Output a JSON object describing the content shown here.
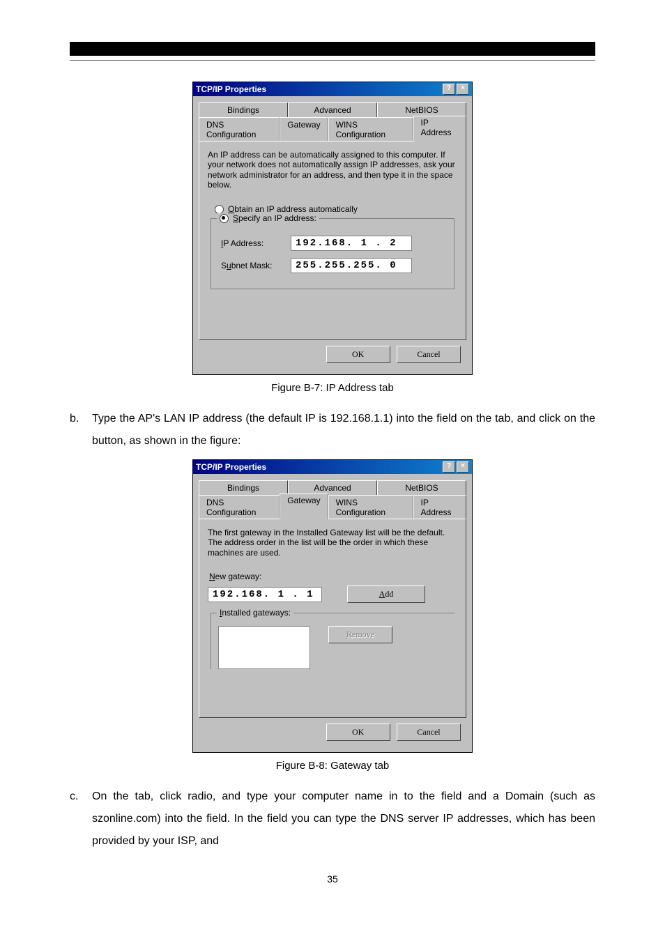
{
  "header_black_bar": "",
  "dialog1": {
    "title": "TCP/IP Properties",
    "help_btn": "?",
    "close_btn": "×",
    "tabs_row1": [
      "Bindings",
      "Advanced",
      "NetBIOS"
    ],
    "tabs_row2": [
      "DNS Configuration",
      "Gateway",
      "WINS Configuration",
      "IP Address"
    ],
    "explain": "An IP address can be automatically assigned to this computer. If your network does not automatically assign IP addresses, ask your network administrator for an address, and then type it in the space below.",
    "radio_obtain_pre": "O",
    "radio_obtain_post": "btain an IP address automatically",
    "radio_specify_pre": "S",
    "radio_specify_post": "pecify an IP address:",
    "ip_label_pre": "I",
    "ip_label_post": "P Address:",
    "ip_value": "192.168. 1 .  2",
    "subnet_label_pre": "u",
    "subnet_label_prefix": "S",
    "subnet_label_post": "bnet Mask:",
    "subnet_value": "255.255.255.  0",
    "ok": "OK",
    "cancel": "Cancel"
  },
  "caption1": "Figure B-7: IP Address tab",
  "para_b": "Type the AP's LAN IP address (the default IP is 192.168.1.1) into the                     field on the                     tab, and click on the             button, as shown in the figure:",
  "dialog2": {
    "title": "TCP/IP Properties",
    "help_btn": "?",
    "close_btn": "×",
    "tabs_row1": [
      "Bindings",
      "Advanced",
      "NetBIOS"
    ],
    "tabs_row2": [
      "DNS Configuration",
      "Gateway",
      "WINS Configuration",
      "IP Address"
    ],
    "explain": "The first gateway in the Installed Gateway list will be the default. The address order in the list will be the order in which these machines are used.",
    "new_gw_label_pre": "N",
    "new_gw_label_post": "ew gateway:",
    "new_gw_value": "192.168. 1 . 1",
    "add_btn_pre": "A",
    "add_btn_post": "dd",
    "installed_label_pre": "I",
    "installed_label_post": "nstalled gateways:",
    "remove_btn_pre": "R",
    "remove_btn_post": "emove",
    "ok": "OK",
    "cancel": "Cancel"
  },
  "caption2": "Figure B-8: Gateway tab",
  "para_c": "On the                               tab, click                          radio, and type your computer name in to the             field and a Domain (such as szonline.com) into the                  field. In the                                                field you can type the DNS server IP addresses, which has been provided by your ISP, and",
  "page_num": "35"
}
